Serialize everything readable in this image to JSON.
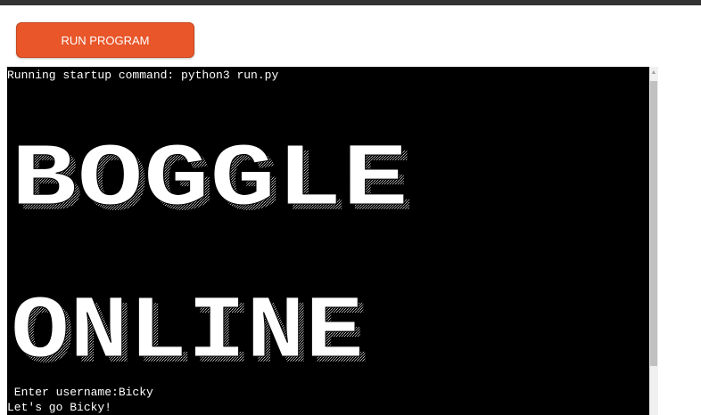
{
  "toolbar": {
    "run_label": "RUN PROGRAM"
  },
  "terminal": {
    "startup_line": "Running startup command: python3 run.py",
    "banner_word_1": "BOGGLE",
    "banner_word_2": "ONLINE",
    "prompt_line": " Enter username:Bicky",
    "welcome_line": "Let's go Bicky!"
  },
  "colors": {
    "accent": "#e8562a",
    "terminal_bg": "#000000",
    "terminal_fg": "#ffffff"
  }
}
